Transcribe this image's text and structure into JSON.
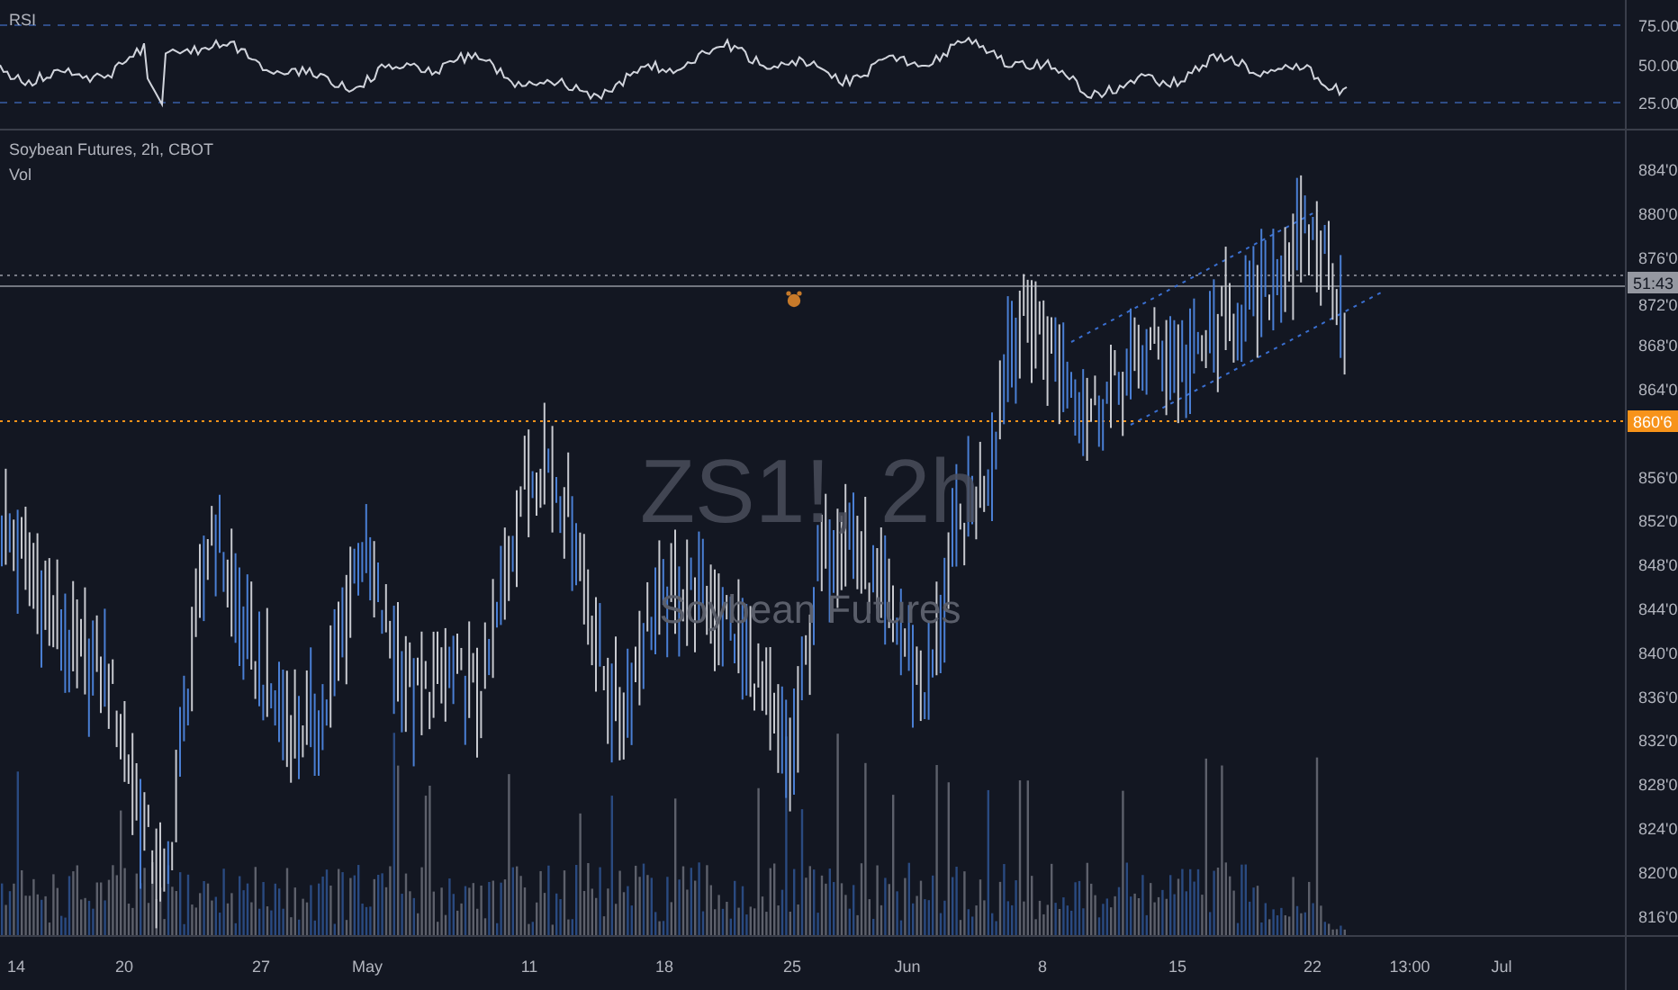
{
  "rsi_pane": {
    "title": "RSI",
    "axis_labels": [
      "75.00",
      "50.00",
      "25.00"
    ]
  },
  "legend": {
    "symbol": "Soybean Futures, 2h, CBOT",
    "indicator": "Vol"
  },
  "watermark": {
    "symbol": "ZS1!, 2h",
    "description": "Soybean Futures"
  },
  "price_axis": {
    "labels": [
      "884'0",
      "880'0",
      "876'0",
      "872'0",
      "868'0",
      "864'0",
      "856'0",
      "852'0",
      "848'0",
      "844'0",
      "840'0",
      "836'0",
      "832'0",
      "828'0",
      "824'0",
      "820'0",
      "816'0"
    ]
  },
  "price_labels": [
    {
      "kind": "countdown",
      "text": "51:43"
    },
    {
      "kind": "alert",
      "text": "860'6"
    }
  ],
  "time_axis": {
    "labels": [
      "14",
      "20",
      "27",
      "May",
      "11",
      "18",
      "25",
      "Jun",
      "8",
      "15",
      "22",
      "13:00",
      "Jul"
    ]
  }
}
